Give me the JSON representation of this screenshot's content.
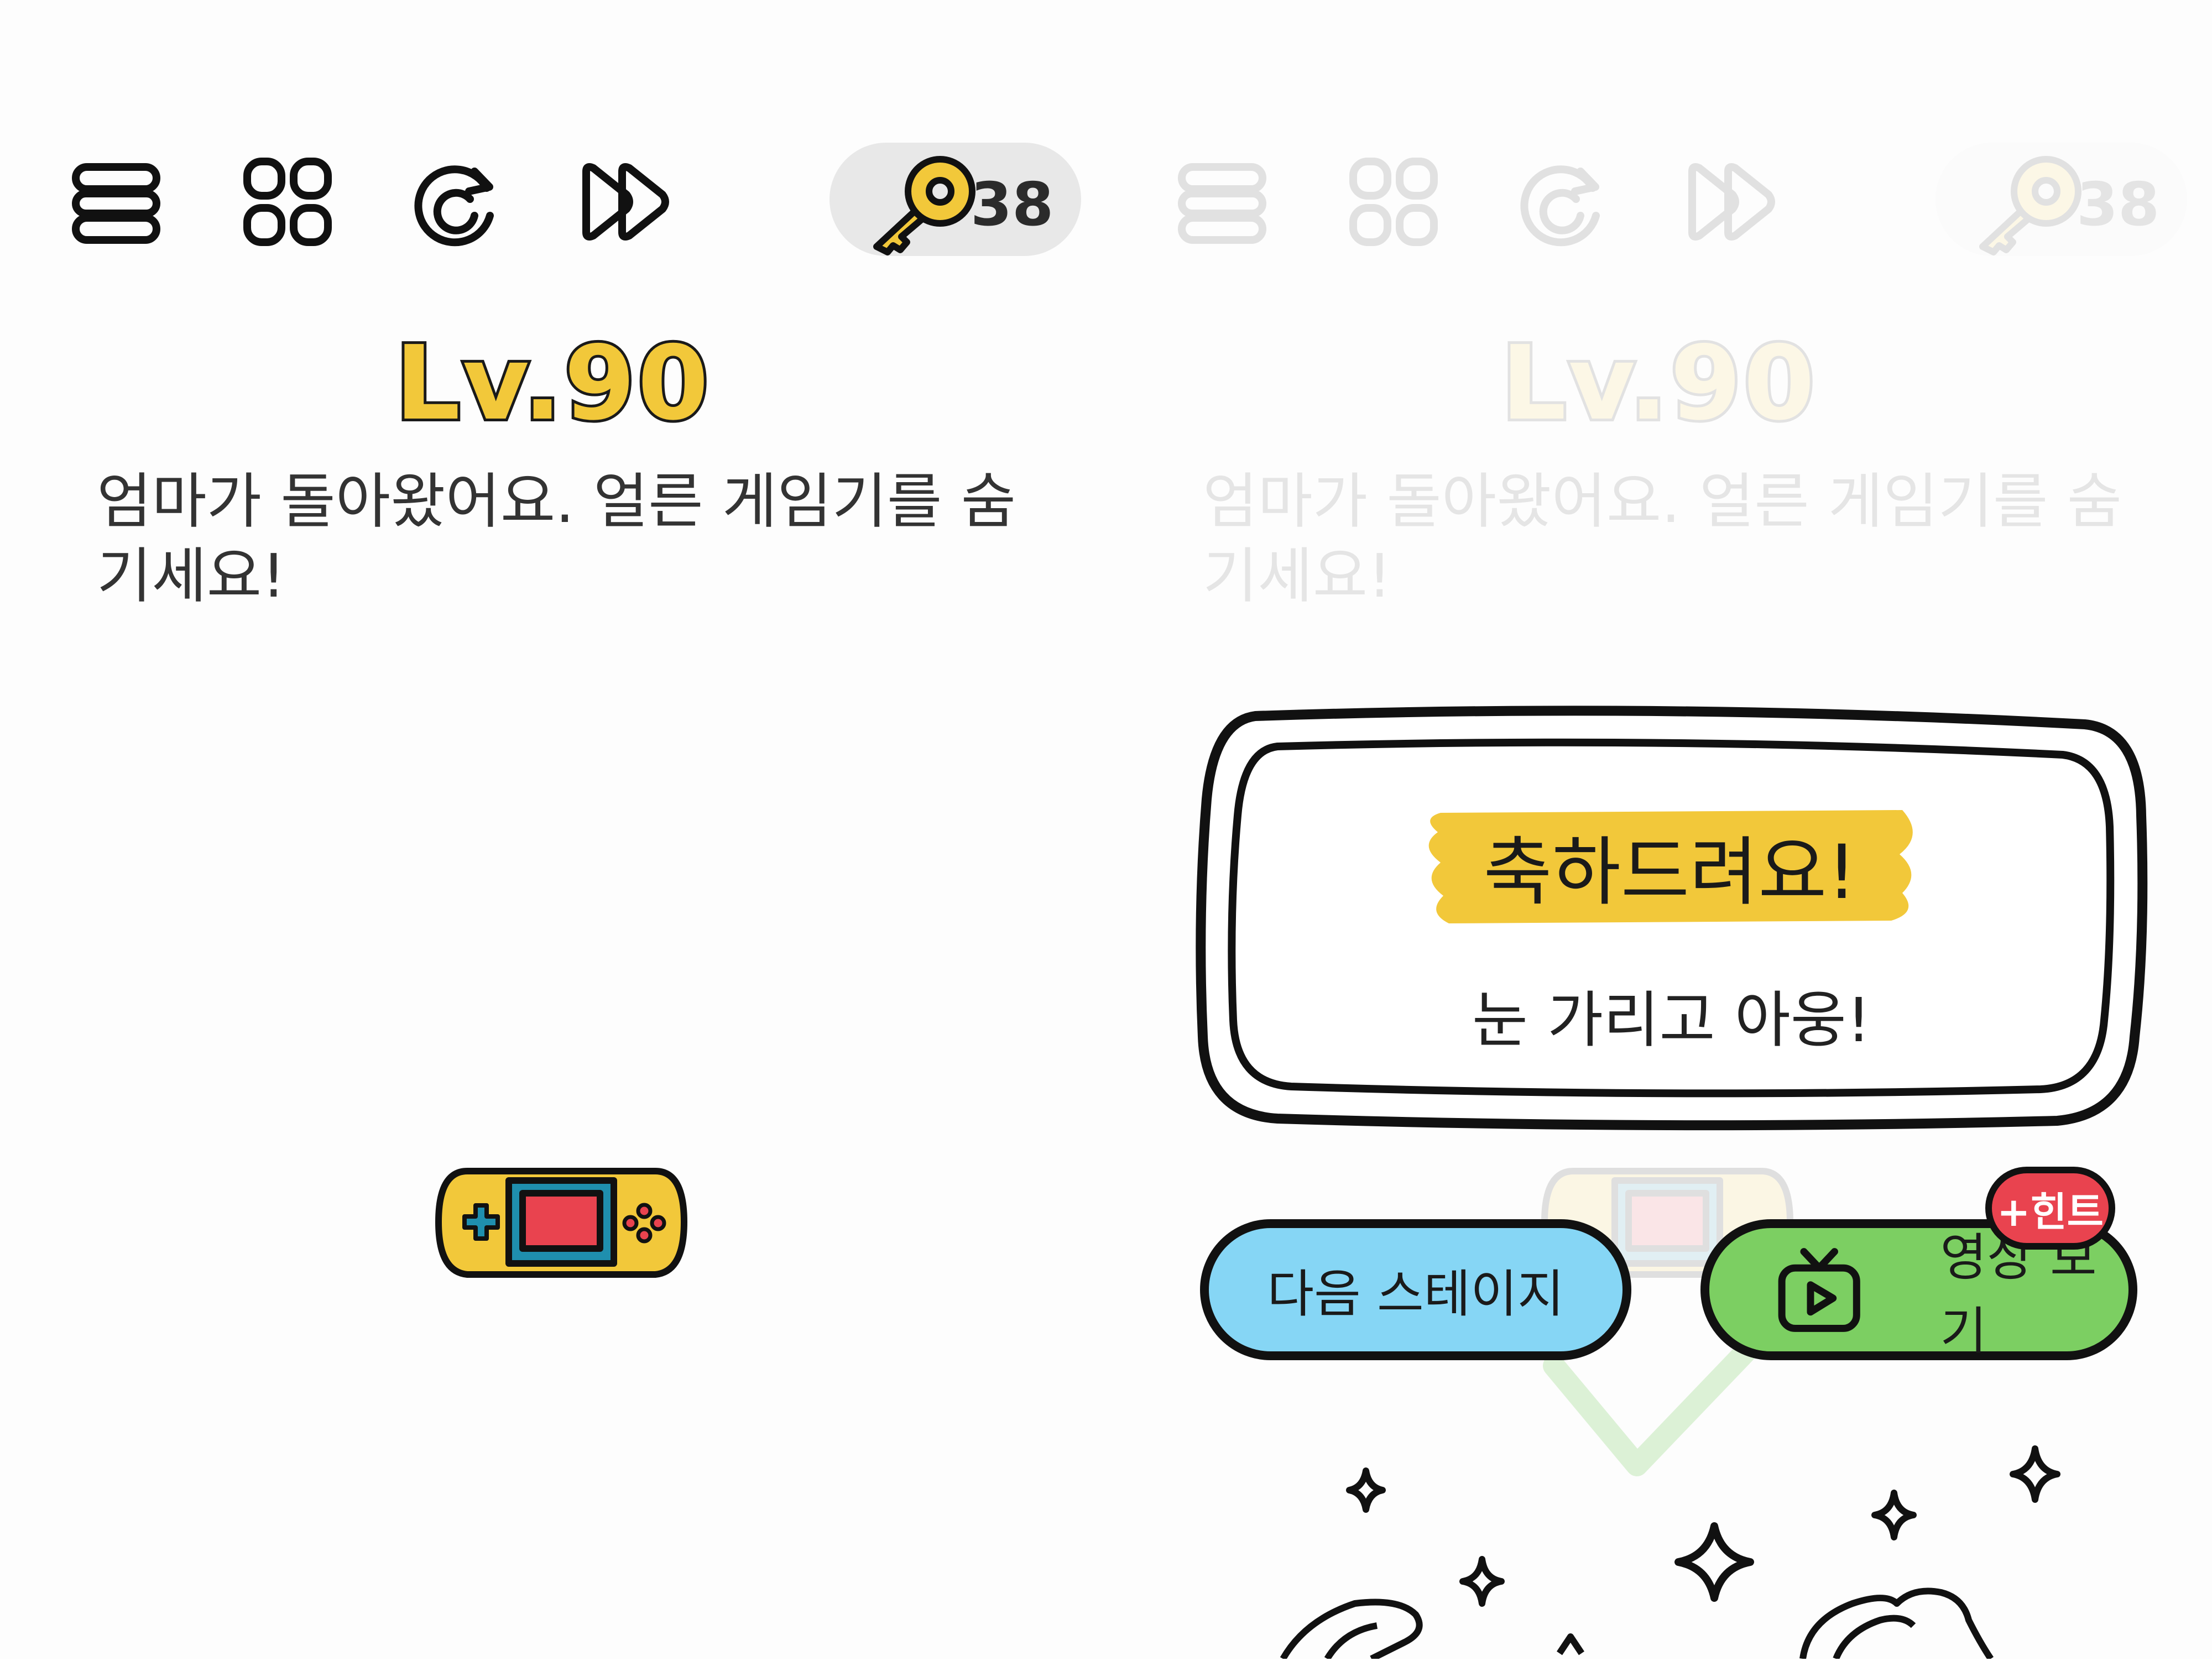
{
  "toolbar": {
    "icons": [
      "menu-icon",
      "grid-icon",
      "restart-icon",
      "skip-icon"
    ]
  },
  "keys": {
    "icon": "key-icon",
    "count": "38"
  },
  "level": {
    "label": "Lv.90"
  },
  "instruction": {
    "text": "엄마가 돌아왔어요. 얼른 게임기를 숨기세요!"
  },
  "dialog": {
    "title": "축하드려요!",
    "subtitle": "눈 가리고 아웅!"
  },
  "buttons": {
    "next_stage": "다음 스테이지",
    "watch_video": "영상 보기",
    "hint_badge": "+힌트"
  },
  "colors": {
    "accent_yellow": "#f2c83a",
    "next_button": "#86d6f5",
    "video_button": "#7ccf62",
    "hint_badge": "#e9434f",
    "device_screen": "#e9434f",
    "device_bezel": "#1f8fae"
  }
}
